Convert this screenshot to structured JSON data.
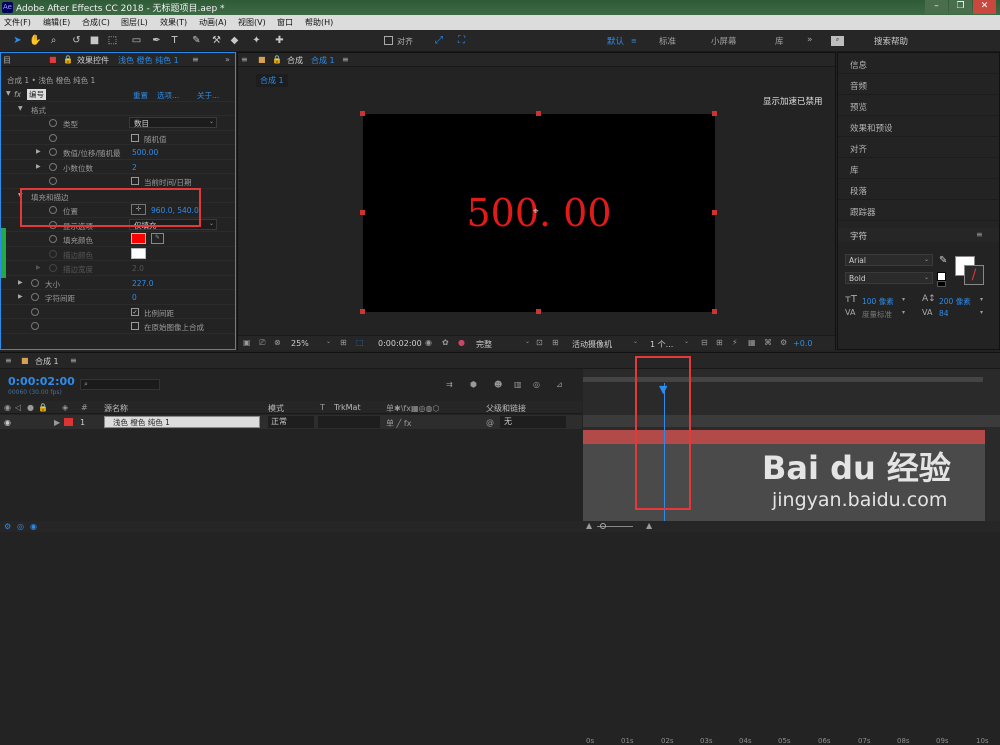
{
  "title": "Adobe After Effects CC 2018 - 无标题项目.aep *",
  "app_icon": "Ae",
  "menu": [
    "文件(F)",
    "编辑(E)",
    "合成(C)",
    "图层(L)",
    "效果(T)",
    "动画(A)",
    "视图(V)",
    "窗口",
    "帮助(H)"
  ],
  "toolbar": {
    "snap_label": "对齐",
    "workspaces": [
      "默认",
      "标准",
      "小屏幕",
      "库"
    ],
    "search_placeholder": "搜索帮助"
  },
  "effects": {
    "tab": "效果控件",
    "layer_name": "浅色 橙色 纯色 1",
    "breadcrumb": "合成 1 • 浅色 橙色 纯色 1",
    "fx_name": "编号",
    "reset": "重置",
    "options": "选项...",
    "about": "关于...",
    "format": "格式",
    "type_label": "类型",
    "type_value": "数目",
    "random": "随机值",
    "value_label": "数值/位移/随机最",
    "value": "500.00",
    "decimals_label": "小数位数",
    "decimals": "2",
    "current_time": "当前时间/日期",
    "fill_stroke": "填充和描边",
    "position_label": "位置",
    "position": "960.0, 540.0",
    "display_label": "显示选项",
    "display_value": "仅填充",
    "fill_color_label": "填充颜色",
    "stroke_color_label": "描边颜色",
    "stroke_width_label": "描边宽度",
    "stroke_width": "2.0",
    "size_label": "大小",
    "size": "227.0",
    "tracking_label": "字符间距",
    "tracking": "0",
    "proportional": "比例间距",
    "composite": "在原始图像上合成"
  },
  "comp": {
    "tab": "合成",
    "name": "合成 1",
    "subtab": "合成 1",
    "accel_note": "显示加速已禁用",
    "display_number": "500. 00",
    "zoom": "25%",
    "time": "0:00:02:00",
    "quality": "完整",
    "camera": "活动摄像机",
    "views": "1 个...",
    "exposure": "+0.0"
  },
  "right_panel": {
    "items": [
      "信息",
      "音频",
      "预览",
      "效果和预设",
      "对齐",
      "库",
      "段落",
      "跟踪器"
    ],
    "character_title": "字符",
    "font": "Arial",
    "style": "Bold",
    "font_size": "100 像素",
    "leading": "200 像素",
    "tracking_label": "度量标准",
    "tracking_value": "84"
  },
  "timeline": {
    "tab": "合成 1",
    "timecode": "0:00:02:00",
    "frame_info": "00060 (30.00 fps)",
    "columns": {
      "source": "源名称",
      "mode": "模式",
      "trkmat": "TrkMat",
      "parent": "父级和链接"
    },
    "layer": {
      "index": "1",
      "name": "浅色 橙色 纯色 1",
      "mode": "正常",
      "parent": "无"
    },
    "ticks": [
      "0s",
      "01s",
      "02s",
      "03s",
      "04s",
      "05s",
      "06s",
      "07s",
      "08s",
      "09s",
      "10s"
    ]
  },
  "watermark": {
    "brand": "Bai du 经验",
    "url": "jingyan.baidu.com"
  },
  "colors": {
    "accent": "#2d8ceb",
    "display_text": "#e11a1a",
    "annotation": "#e23a3a"
  }
}
